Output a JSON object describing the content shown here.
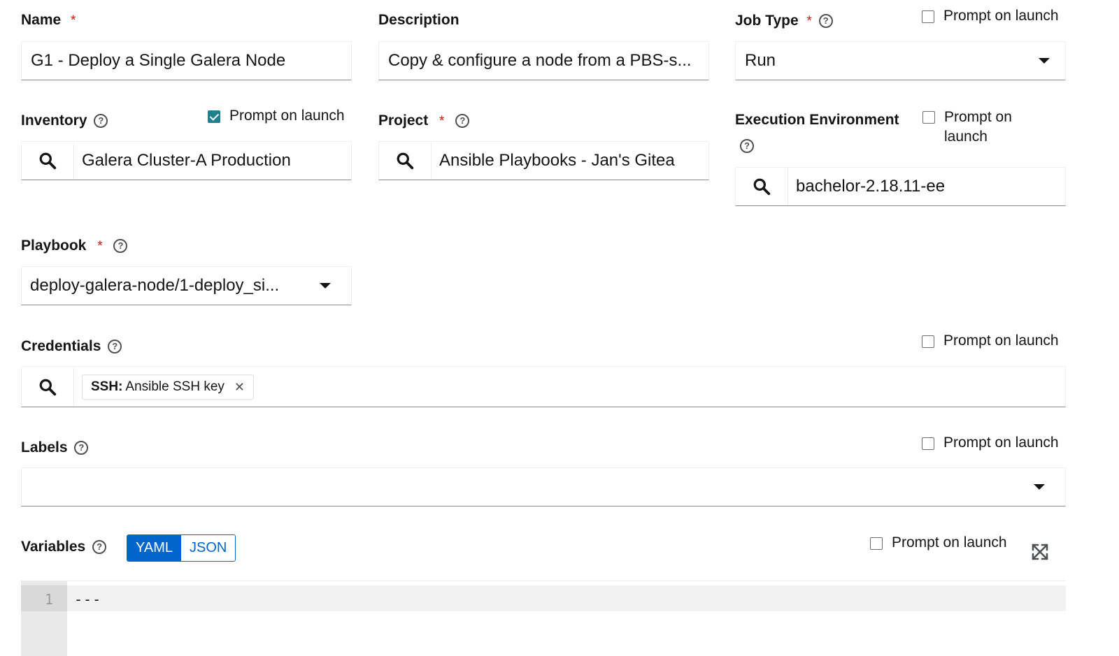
{
  "name": {
    "label": "Name",
    "value": "G1 - Deploy a Single Galera Node"
  },
  "description": {
    "label": "Description",
    "value": "Copy & configure a node from a PBS-s..."
  },
  "job_type": {
    "label": "Job Type",
    "value": "Run",
    "prompt_label": "Prompt on launch",
    "prompt_checked": false
  },
  "inventory": {
    "label": "Inventory",
    "value": "Galera Cluster-A Production",
    "prompt_label": "Prompt on launch",
    "prompt_checked": true
  },
  "project": {
    "label": "Project",
    "value": "Ansible Playbooks - Jan's Gitea"
  },
  "execution_environment": {
    "label": "Execution Environment",
    "value": "bachelor-2.18.11-ee",
    "prompt_line1": "Prompt on",
    "prompt_line2": "launch",
    "prompt_checked": false
  },
  "playbook": {
    "label": "Playbook",
    "value": "deploy-galera-node/1-deploy_si..."
  },
  "credentials": {
    "label": "Credentials",
    "prompt_label": "Prompt on launch",
    "prompt_checked": false,
    "chip_type": "SSH:",
    "chip_name": "Ansible SSH key",
    "chip_remove": "✕"
  },
  "labels": {
    "label": "Labels",
    "prompt_label": "Prompt on launch",
    "prompt_checked": false
  },
  "variables": {
    "label": "Variables",
    "modes": [
      "YAML",
      "JSON"
    ],
    "active_mode": "YAML",
    "prompt_label": "Prompt on launch",
    "prompt_checked": false,
    "line_number": "1",
    "code": "---"
  },
  "help_glyph": "?",
  "required_mark": "*",
  "colors": {
    "accent": "#0066cc",
    "checkbox_checked": "#1f8090",
    "required": "#c9190b"
  }
}
